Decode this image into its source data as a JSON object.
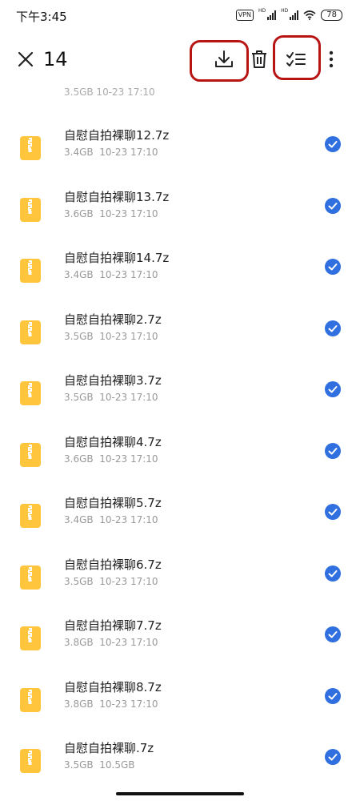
{
  "status": {
    "time": "下午3:45",
    "vpn": "VPN",
    "hd1": "HD",
    "hd2": "HD",
    "battery": "78"
  },
  "toolbar": {
    "selected_count": "14"
  },
  "list": {
    "top_partial_meta": "3.5GB  10-23 17:10",
    "items": [
      {
        "name": "自慰自拍裸聊12.7z",
        "size": "3.4GB",
        "date": "10-23 17:10"
      },
      {
        "name": "自慰自拍裸聊13.7z",
        "size": "3.6GB",
        "date": "10-23 17:10"
      },
      {
        "name": "自慰自拍裸聊14.7z",
        "size": "3.4GB",
        "date": "10-23 17:10"
      },
      {
        "name": "自慰自拍裸聊2.7z",
        "size": "3.5GB",
        "date": "10-23 17:10"
      },
      {
        "name": "自慰自拍裸聊3.7z",
        "size": "3.5GB",
        "date": "10-23 17:10"
      },
      {
        "name": "自慰自拍裸聊4.7z",
        "size": "3.6GB",
        "date": "10-23 17:10"
      },
      {
        "name": "自慰自拍裸聊5.7z",
        "size": "3.4GB",
        "date": "10-23 17:10"
      },
      {
        "name": "自慰自拍裸聊6.7z",
        "size": "3.5GB",
        "date": "10-23 17:10"
      },
      {
        "name": "自慰自拍裸聊7.7z",
        "size": "3.8GB",
        "date": "10-23 17:10"
      },
      {
        "name": "自慰自拍裸聊8.7z",
        "size": "3.8GB",
        "date": "10-23 17:10"
      },
      {
        "name": "自慰自拍裸聊.7z",
        "size": "3.5GB",
        "date": "10.5GB"
      }
    ]
  },
  "colors": {
    "accent_blue": "#2f6fe0",
    "archive_yellow": "#ffc53d",
    "highlight_red": "#b81414"
  },
  "icons": [
    "close-icon",
    "download-icon",
    "trash-icon",
    "checklist-icon",
    "more-vertical-icon",
    "archive-file-icon",
    "check-circle-icon"
  ]
}
